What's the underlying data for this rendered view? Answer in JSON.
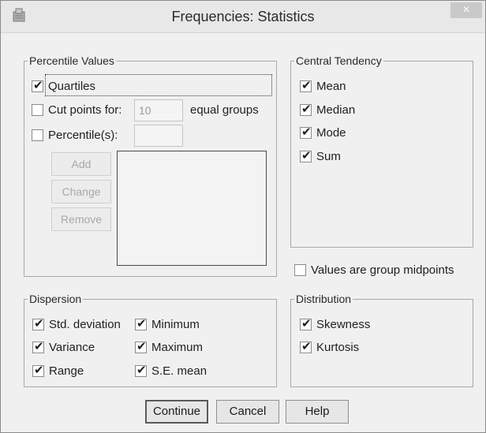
{
  "window": {
    "title": "Frequencies: Statistics",
    "close_glyph": "×"
  },
  "percentile": {
    "legend": "Percentile Values",
    "quartiles": {
      "label": "Quartiles",
      "checked": true
    },
    "cut_points": {
      "label": "Cut points for:",
      "value": "10",
      "suffix": "equal groups",
      "checked": false
    },
    "percentiles": {
      "label": "Percentile(s):",
      "value": "",
      "checked": false
    },
    "buttons": {
      "add": "Add",
      "change": "Change",
      "remove": "Remove"
    }
  },
  "central": {
    "legend": "Central Tendency",
    "items": [
      {
        "label": "Mean",
        "checked": true
      },
      {
        "label": "Median",
        "checked": true
      },
      {
        "label": "Mode",
        "checked": true
      },
      {
        "label": "Sum",
        "checked": true
      }
    ]
  },
  "midpoints": {
    "label": "Values are group midpoints",
    "checked": false
  },
  "dispersion": {
    "legend": "Dispersion",
    "items": [
      {
        "label": "Std. deviation",
        "checked": true
      },
      {
        "label": "Minimum",
        "checked": true
      },
      {
        "label": "Variance",
        "checked": true
      },
      {
        "label": "Maximum",
        "checked": true
      },
      {
        "label": "Range",
        "checked": true
      },
      {
        "label": "S.E. mean",
        "checked": true
      }
    ]
  },
  "distribution": {
    "legend": "Distribution",
    "items": [
      {
        "label": "Skewness",
        "checked": true
      },
      {
        "label": "Kurtosis",
        "checked": true
      }
    ]
  },
  "footer": {
    "continue": "Continue",
    "cancel": "Cancel",
    "help": "Help"
  }
}
